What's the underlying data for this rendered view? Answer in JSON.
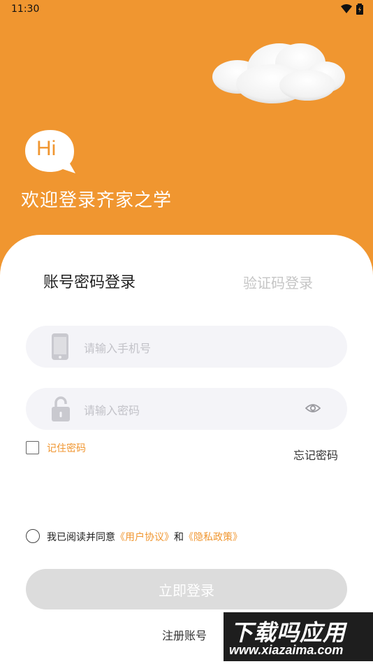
{
  "status_bar": {
    "time": "11:30"
  },
  "header": {
    "bubble_text": "Hi",
    "welcome": "欢迎登录齐家之学"
  },
  "tabs": {
    "account": "账号密码登录",
    "code": "验证码登录"
  },
  "phone_field": {
    "placeholder": "请输入手机号"
  },
  "password_field": {
    "placeholder": "请输入密码"
  },
  "remember": {
    "label": "记住密码",
    "checked": false
  },
  "forgot": {
    "label": "忘记密码"
  },
  "agreement": {
    "prefix": "我已阅读并同意",
    "user_agreement": "《用户协议》",
    "and": "和",
    "privacy_policy": "《隐私政策》",
    "checked": false
  },
  "login_button": {
    "label": "立即登录"
  },
  "register": {
    "label": "注册账号"
  },
  "watermark": {
    "title": "下载吗应用",
    "url": "www.xiazaima.com"
  },
  "colors": {
    "accent": "#f09630",
    "card": "#ffffff",
    "field_bg": "#f4f4f8",
    "button_disabled": "#dcdcdc"
  },
  "icons": [
    "wifi-icon",
    "battery-icon",
    "phone-icon",
    "lock-icon",
    "eye-icon",
    "cloud-icon",
    "hi-bubble-icon"
  ]
}
